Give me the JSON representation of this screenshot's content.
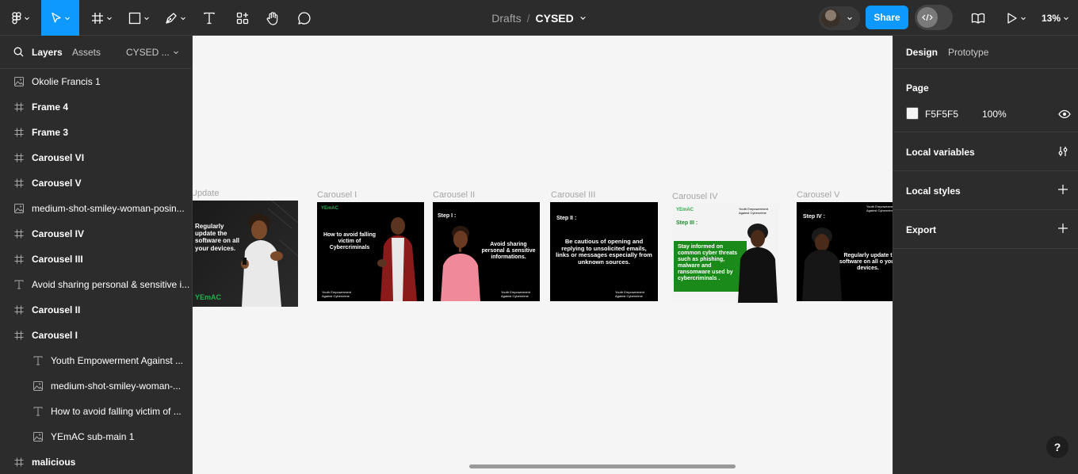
{
  "toolbar": {
    "breadcrumb_folder": "Drafts",
    "breadcrumb_sep": "/",
    "file_name": "CYSED",
    "share_label": "Share",
    "zoom": "13%",
    "icons": [
      "figma-menu-icon",
      "move-tool-icon",
      "frame-tool-icon",
      "shape-tool-icon",
      "pen-tool-icon",
      "text-tool-icon",
      "resources-icon",
      "hand-tool-icon",
      "comment-icon",
      "library-icon",
      "present-icon",
      "dev-mode-icon"
    ]
  },
  "left_panel": {
    "tab_layers": "Layers",
    "tab_assets": "Assets",
    "page_name": "CYSED ...",
    "layers": [
      {
        "label": "Okolie Francis 1",
        "type": "image",
        "level": 0,
        "bold": false
      },
      {
        "label": "Frame 4",
        "type": "frame",
        "level": 0,
        "bold": true
      },
      {
        "label": "Frame 3",
        "type": "frame",
        "level": 0,
        "bold": true
      },
      {
        "label": "Carousel VI",
        "type": "frame",
        "level": 0,
        "bold": true
      },
      {
        "label": "Carousel V",
        "type": "frame",
        "level": 0,
        "bold": true
      },
      {
        "label": "medium-shot-smiley-woman-posin...",
        "type": "image",
        "level": 0,
        "bold": false
      },
      {
        "label": "Carousel IV",
        "type": "frame",
        "level": 0,
        "bold": true
      },
      {
        "label": "Carousel III",
        "type": "frame",
        "level": 0,
        "bold": true
      },
      {
        "label": "Avoid sharing personal & sensitive i...",
        "type": "text",
        "level": 0,
        "bold": false
      },
      {
        "label": "Carousel II",
        "type": "frame",
        "level": 0,
        "bold": true
      },
      {
        "label": "Carousel I",
        "type": "frame",
        "level": 0,
        "bold": true
      },
      {
        "label": "Youth Empowerment Against ...",
        "type": "text",
        "level": 1,
        "bold": false
      },
      {
        "label": "medium-shot-smiley-woman-...",
        "type": "image",
        "level": 1,
        "bold": false
      },
      {
        "label": "How to avoid falling victim of ...",
        "type": "text",
        "level": 1,
        "bold": false
      },
      {
        "label": "YEmAC sub-main 1",
        "type": "image",
        "level": 1,
        "bold": false
      },
      {
        "label": "malicious",
        "type": "frame",
        "level": 0,
        "bold": true
      }
    ]
  },
  "canvas": {
    "background": "#F5F5F5",
    "frames": [
      {
        "label": "Update",
        "text": "Regularly update the software on all your devices.",
        "logo": "YEmAC"
      },
      {
        "label": "Carousel I",
        "text": "How to avoid falling victim of Cybercriminals",
        "logo": "YEmAC",
        "footer": "Youth Empowerment Against Cybercrime"
      },
      {
        "label": "Carousel II",
        "step": "Step I :",
        "text": "Avoid sharing personal & sensitive informations.",
        "footer": "Youth Empowerment Against Cybercrime"
      },
      {
        "label": "Carousel III",
        "step": "Step II :",
        "text": "Be cautious of opening and replying to unsolicited emails, links or messages especially from unknown sources.",
        "footer": "Youth Empowerment Against Cybercrime"
      },
      {
        "label": "Carousel IV",
        "step": "Step III :",
        "text": "Stay informed on common cyber threats such as phishing, malware and ransomware used by cybercriminals .",
        "logo": "YEmAC",
        "header": "Youth Empowerment Against Cybercrime"
      },
      {
        "label": "Carousel V",
        "step": "Step IV :",
        "text": "Regularly update t software on all o your devices.",
        "header": "Youth Empowerment Against Cybercrime"
      }
    ]
  },
  "right_panel": {
    "tab_design": "Design",
    "tab_prototype": "Prototype",
    "page_heading": "Page",
    "page_color": "F5F5F5",
    "page_opacity": "100%",
    "local_variables": "Local variables",
    "local_styles": "Local styles",
    "export": "Export",
    "help": "?"
  },
  "colors": {
    "accent": "#0d99ff",
    "brand_green": "#22b14c",
    "panel": "#2c2c2c"
  }
}
